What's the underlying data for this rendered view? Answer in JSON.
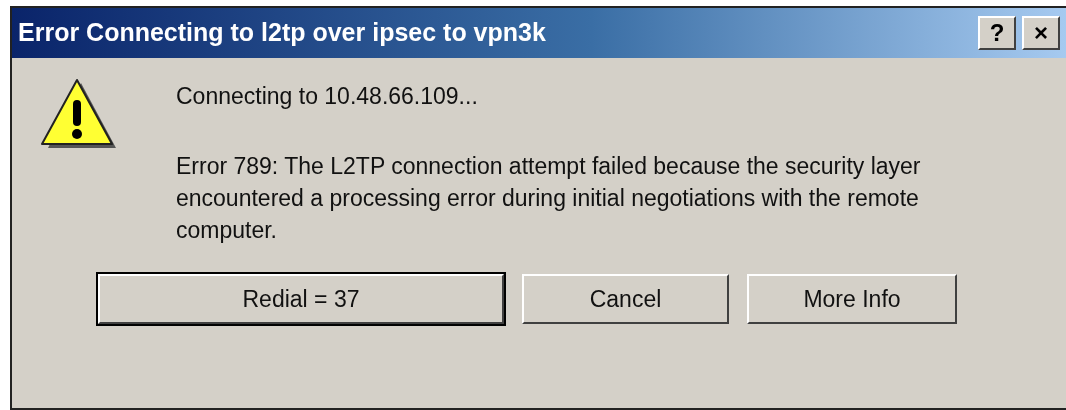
{
  "window": {
    "title": "Error Connecting to l2tp over ipsec to vpn3k",
    "title_buttons": [
      "?",
      "×"
    ]
  },
  "message": {
    "status": "Connecting to 10.48.66.109...",
    "error": "Error 789: The L2TP connection attempt failed because the security layer encountered a processing error during initial negotiations with the remote computer."
  },
  "buttons": [
    {
      "label": "Redial = 37",
      "default": true
    },
    {
      "label": "Cancel",
      "default": false
    },
    {
      "label": "More Info",
      "default": false
    }
  ]
}
